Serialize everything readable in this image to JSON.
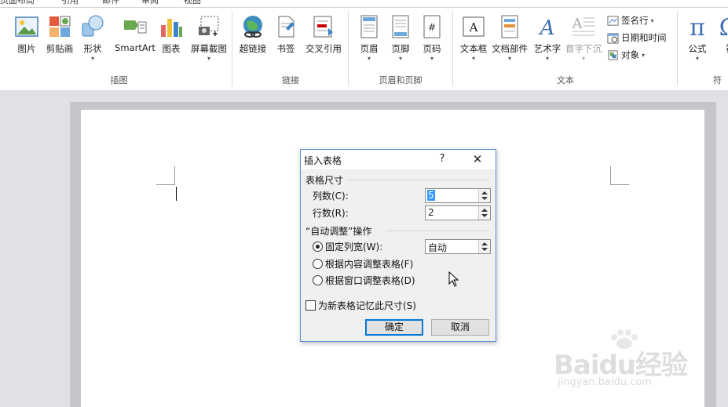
{
  "top_tabs": [
    "页面布局",
    "引用",
    "邮件",
    "审阅",
    "视图"
  ],
  "ribbon": {
    "groups": [
      {
        "label": "插图",
        "buttons": [
          {
            "label": "图片",
            "icon": "picture-icon"
          },
          {
            "label": "剪贴画",
            "icon": "clipart-icon"
          },
          {
            "label": "形状",
            "icon": "shapes-icon"
          },
          {
            "label": "SmartArt",
            "icon": "smartart-icon"
          },
          {
            "label": "图表",
            "icon": "chart-icon"
          },
          {
            "label": "屏幕截图",
            "icon": "screenshot-icon"
          }
        ]
      },
      {
        "label": "链接",
        "buttons": [
          {
            "label": "超链接",
            "icon": "hyperlink-icon"
          },
          {
            "label": "书签",
            "icon": "bookmark-icon"
          },
          {
            "label": "交叉引用",
            "icon": "cross-reference-icon"
          }
        ]
      },
      {
        "label": "页眉和页脚",
        "buttons": [
          {
            "label": "页眉",
            "icon": "header-icon"
          },
          {
            "label": "页脚",
            "icon": "footer-icon"
          },
          {
            "label": "页码",
            "icon": "page-number-icon"
          }
        ]
      },
      {
        "label": "文本",
        "buttons": [
          {
            "label": "文本框",
            "icon": "textbox-icon"
          },
          {
            "label": "文档部件",
            "icon": "quick-parts-icon"
          },
          {
            "label": "艺术字",
            "icon": "wordart-icon"
          },
          {
            "label": "首字下沉",
            "icon": "dropcap-icon"
          }
        ],
        "small": [
          {
            "label": "签名行",
            "icon": "signature-line-icon"
          },
          {
            "label": "日期和时间",
            "icon": "date-time-icon"
          },
          {
            "label": "对象",
            "icon": "object-icon"
          }
        ]
      },
      {
        "label": "符",
        "buttons": [
          {
            "label": "公式",
            "icon": "equation-icon"
          },
          {
            "label": "符",
            "icon": "symbol-icon"
          }
        ]
      }
    ]
  },
  "dialog": {
    "title": "插入表格",
    "help": "?",
    "close": "✕",
    "table_size": {
      "title": "表格尺寸",
      "columns_label": "列数(C):",
      "columns_value": "5",
      "rows_label": "行数(R):",
      "rows_value": "2"
    },
    "autofit": {
      "title": "“自动调整”操作",
      "fixed_label": "固定列宽(W):",
      "fixed_value": "自动",
      "content_label": "根据内容调整表格(F)",
      "window_label": "根据窗口调整表格(D)",
      "selected": "fixed"
    },
    "remember_label": "为新表格记忆此尺寸(S)",
    "remember_checked": false,
    "ok_label": "确定",
    "cancel_label": "取消"
  },
  "watermark": {
    "logo": "Baidu经验",
    "url": "jingyan.baidu.com"
  }
}
